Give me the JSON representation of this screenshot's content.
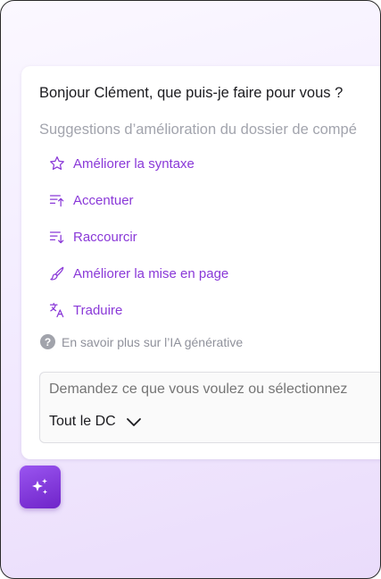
{
  "assistant": {
    "greeting": "Bonjour Clément, que puis-je faire pour vous ?",
    "suggestions_title": "Suggestions d’amélioration du dossier de compé",
    "actions": [
      {
        "label": "Améliorer la syntaxe",
        "icon": "star-icon"
      },
      {
        "label": "Accentuer",
        "icon": "lines-arrow-up-icon"
      },
      {
        "label": "Raccourcir",
        "icon": "lines-arrow-down-icon"
      },
      {
        "label": "Améliorer la mise en page",
        "icon": "brush-icon"
      },
      {
        "label": "Traduire",
        "icon": "translate-icon"
      }
    ],
    "learn_more": "En savoir plus sur l’IA générative",
    "prompt": {
      "placeholder": "Demandez ce que vous voulez ou sélectionnez",
      "value": ""
    },
    "scope_label": "Tout le DC"
  },
  "launcher": {
    "icon": "sparkles-icon"
  },
  "colors": {
    "accent": "#8a39d8",
    "launcher_bg": "#7b2fd6",
    "greeting_text": "#1b1b1f",
    "muted_text": "#a2a4ad"
  }
}
